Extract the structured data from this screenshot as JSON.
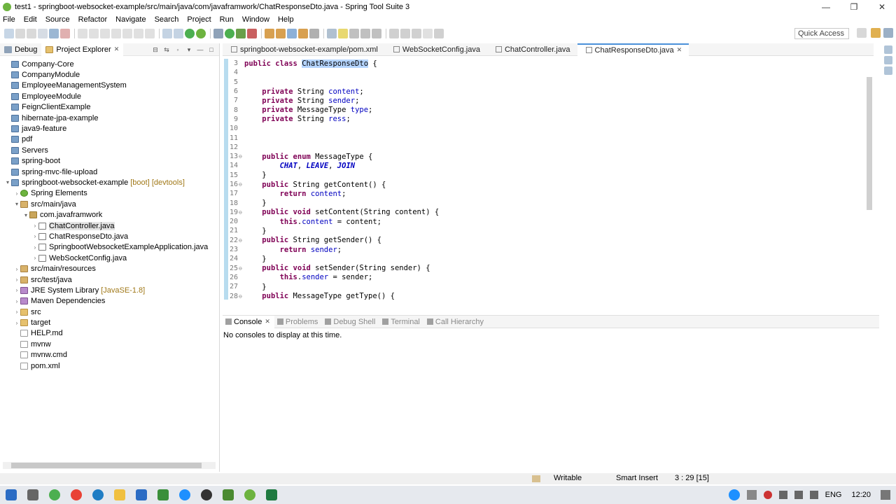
{
  "window": {
    "title": "test1 - springboot-websocket-example/src/main/java/com/javaframwork/ChatResponseDto.java - Spring Tool Suite 3",
    "minimize": "—",
    "maximize": "❐",
    "close": "✕"
  },
  "menu": [
    "File",
    "Edit",
    "Source",
    "Refactor",
    "Navigate",
    "Search",
    "Project",
    "Run",
    "Window",
    "Help"
  ],
  "toolbar": {
    "quick_access": "Quick Access"
  },
  "left_panel": {
    "tabs": [
      {
        "label": "Debug"
      },
      {
        "label": "Project Explorer",
        "close": "✕"
      }
    ],
    "tree": [
      {
        "label": "Company-Core",
        "indent": 0,
        "expander": "",
        "icon": "proj"
      },
      {
        "label": "CompanyModule",
        "indent": 0,
        "expander": "",
        "icon": "proj"
      },
      {
        "label": "EmployeeManagementSystem",
        "indent": 0,
        "expander": "",
        "icon": "proj"
      },
      {
        "label": "EmployeeModule",
        "indent": 0,
        "expander": "",
        "icon": "proj"
      },
      {
        "label": "FeignClientExample",
        "indent": 0,
        "expander": "",
        "icon": "proj"
      },
      {
        "label": "hibernate-jpa-example",
        "indent": 0,
        "expander": "",
        "icon": "proj"
      },
      {
        "label": "java9-feature",
        "indent": 0,
        "expander": "",
        "icon": "proj"
      },
      {
        "label": "pdf",
        "indent": 0,
        "expander": "",
        "icon": "proj"
      },
      {
        "label": "Servers",
        "indent": 0,
        "expander": "",
        "icon": "proj"
      },
      {
        "label": "spring-boot",
        "indent": 0,
        "expander": "",
        "icon": "proj"
      },
      {
        "label": "spring-mvc-file-upload",
        "indent": 0,
        "expander": "",
        "icon": "proj"
      },
      {
        "label": "springboot-websocket-example",
        "decoration": "[boot] [devtools]",
        "indent": 0,
        "expander": "▾",
        "icon": "proj"
      },
      {
        "label": "Spring Elements",
        "indent": 1,
        "expander": "›",
        "icon": "spring"
      },
      {
        "label": "src/main/java",
        "indent": 1,
        "expander": "▾",
        "icon": "src"
      },
      {
        "label": "com.javaframwork",
        "indent": 2,
        "expander": "▾",
        "icon": "pkg"
      },
      {
        "label": "ChatController.java",
        "indent": 3,
        "expander": "›",
        "icon": "java",
        "selected": true
      },
      {
        "label": "ChatResponseDto.java",
        "indent": 3,
        "expander": "›",
        "icon": "java"
      },
      {
        "label": "SpringbootWebsocketExampleApplication.java",
        "indent": 3,
        "expander": "›",
        "icon": "java"
      },
      {
        "label": "WebSocketConfig.java",
        "indent": 3,
        "expander": "›",
        "icon": "java"
      },
      {
        "label": "src/main/resources",
        "indent": 1,
        "expander": "›",
        "icon": "src"
      },
      {
        "label": "src/test/java",
        "indent": 1,
        "expander": "›",
        "icon": "src"
      },
      {
        "label": "JRE System Library",
        "decoration": "[JavaSE-1.8]",
        "indent": 1,
        "expander": "›",
        "icon": "lib"
      },
      {
        "label": "Maven Dependencies",
        "indent": 1,
        "expander": "›",
        "icon": "lib"
      },
      {
        "label": "src",
        "indent": 1,
        "expander": "›",
        "icon": "folder"
      },
      {
        "label": "target",
        "indent": 1,
        "expander": "›",
        "icon": "folder"
      },
      {
        "label": "HELP.md",
        "indent": 1,
        "expander": "",
        "icon": "file"
      },
      {
        "label": "mvnw",
        "indent": 1,
        "expander": "",
        "icon": "file"
      },
      {
        "label": "mvnw.cmd",
        "indent": 1,
        "expander": "",
        "icon": "file"
      },
      {
        "label": "pom.xml",
        "indent": 1,
        "expander": "",
        "icon": "file"
      }
    ]
  },
  "editor": {
    "tabs": [
      {
        "label": "springboot-websocket-example/pom.xml"
      },
      {
        "label": "WebSocketConfig.java"
      },
      {
        "label": "ChatController.java"
      },
      {
        "label": "ChatResponseDto.java",
        "active": true,
        "close": "✕"
      }
    ],
    "lines": [
      {
        "n": "3",
        "fold": "",
        "html": "<span class=\"kw\">public class</span> <span class=\"hl\">ChatResponseDto</span> {"
      },
      {
        "n": "4",
        "fold": "",
        "html": ""
      },
      {
        "n": "5",
        "fold": "",
        "html": ""
      },
      {
        "n": "6",
        "fold": "",
        "html": "    <span class=\"kw\">private</span> String <span class=\"fld\">content</span>;"
      },
      {
        "n": "7",
        "fold": "",
        "html": "    <span class=\"kw\">private</span> String <span class=\"fld\">sender</span>;"
      },
      {
        "n": "8",
        "fold": "",
        "html": "    <span class=\"kw\">private</span> MessageType <span class=\"fld\">type</span>;"
      },
      {
        "n": "9",
        "fold": "",
        "html": "    <span class=\"kw\">private</span> String <span class=\"fld\">ress</span>;"
      },
      {
        "n": "10",
        "fold": "",
        "html": ""
      },
      {
        "n": "11",
        "fold": "",
        "html": ""
      },
      {
        "n": "12",
        "fold": "",
        "html": ""
      },
      {
        "n": "13",
        "fold": "⊖",
        "html": "    <span class=\"kw\">public enum</span> MessageType {"
      },
      {
        "n": "14",
        "fold": "",
        "html": "        <span class=\"en\">CHAT</span>, <span class=\"en\">LEAVE</span>, <span class=\"en\">JOIN</span>"
      },
      {
        "n": "15",
        "fold": "",
        "html": "    }"
      },
      {
        "n": "16",
        "fold": "⊖",
        "html": "    <span class=\"kw\">public</span> String getContent() {"
      },
      {
        "n": "17",
        "fold": "",
        "html": "        <span class=\"kw\">return</span> <span class=\"fld\">content</span>;"
      },
      {
        "n": "18",
        "fold": "",
        "html": "    }"
      },
      {
        "n": "19",
        "fold": "⊖",
        "html": "    <span class=\"kw\">public void</span> setContent(String content) {"
      },
      {
        "n": "20",
        "fold": "",
        "html": "        <span class=\"kw\">this</span>.<span class=\"fld\">content</span> = content;"
      },
      {
        "n": "21",
        "fold": "",
        "html": "    }"
      },
      {
        "n": "22",
        "fold": "⊖",
        "html": "    <span class=\"kw\">public</span> String getSender() {"
      },
      {
        "n": "23",
        "fold": "",
        "html": "        <span class=\"kw\">return</span> <span class=\"fld\">sender</span>;"
      },
      {
        "n": "24",
        "fold": "",
        "html": "    }"
      },
      {
        "n": "25",
        "fold": "⊖",
        "html": "    <span class=\"kw\">public void</span> setSender(String sender) {"
      },
      {
        "n": "26",
        "fold": "",
        "html": "        <span class=\"kw\">this</span>.<span class=\"fld\">sender</span> = sender;"
      },
      {
        "n": "27",
        "fold": "",
        "html": "    }"
      },
      {
        "n": "28",
        "fold": "⊖",
        "html": "    <span class=\"kw\">public</span> MessageType getType() {"
      }
    ]
  },
  "console": {
    "tabs": [
      {
        "label": "Console",
        "active": true,
        "close": "✕"
      },
      {
        "label": "Problems"
      },
      {
        "label": "Debug Shell"
      },
      {
        "label": "Terminal"
      },
      {
        "label": "Call Hierarchy"
      }
    ],
    "message": "No consoles to display at this time."
  },
  "status": {
    "writable": "Writable",
    "insert_mode": "Smart Insert",
    "position": "3 : 29 [15]"
  },
  "tray": {
    "language": "ENG",
    "time": "12:20"
  },
  "colors": {
    "keyword": "#7f0055",
    "field": "#0000c0",
    "selection": "#b5d5ff",
    "accent": "#4a90d9"
  }
}
